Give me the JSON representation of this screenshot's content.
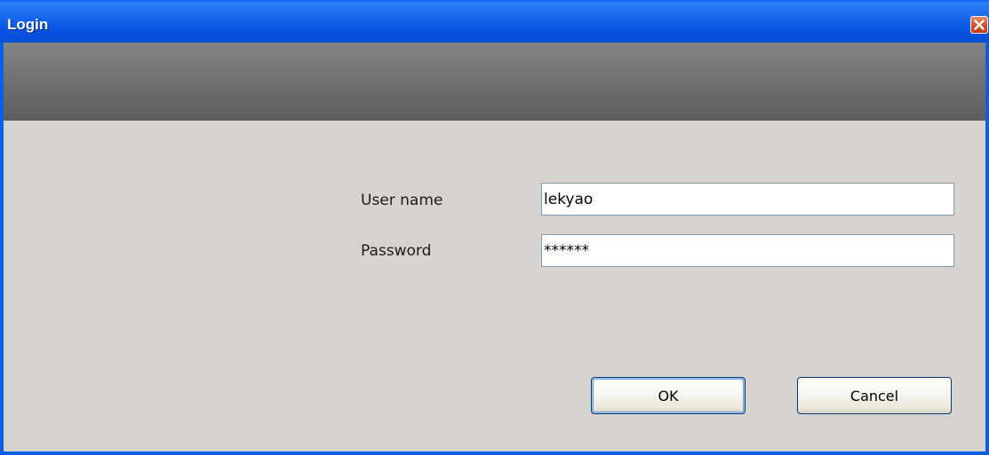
{
  "window": {
    "title": "Login"
  },
  "form": {
    "username_label": "User name",
    "username_value": "lekyao",
    "password_label": "Password",
    "password_value": "******"
  },
  "buttons": {
    "ok_label": "OK",
    "cancel_label": "Cancel"
  },
  "icons": {
    "close": "close-icon"
  },
  "colors": {
    "titlebar": "#0a5ee8",
    "banner": "#6c6e70",
    "body": "#d6d3ce",
    "close_button": "#d8522e"
  }
}
